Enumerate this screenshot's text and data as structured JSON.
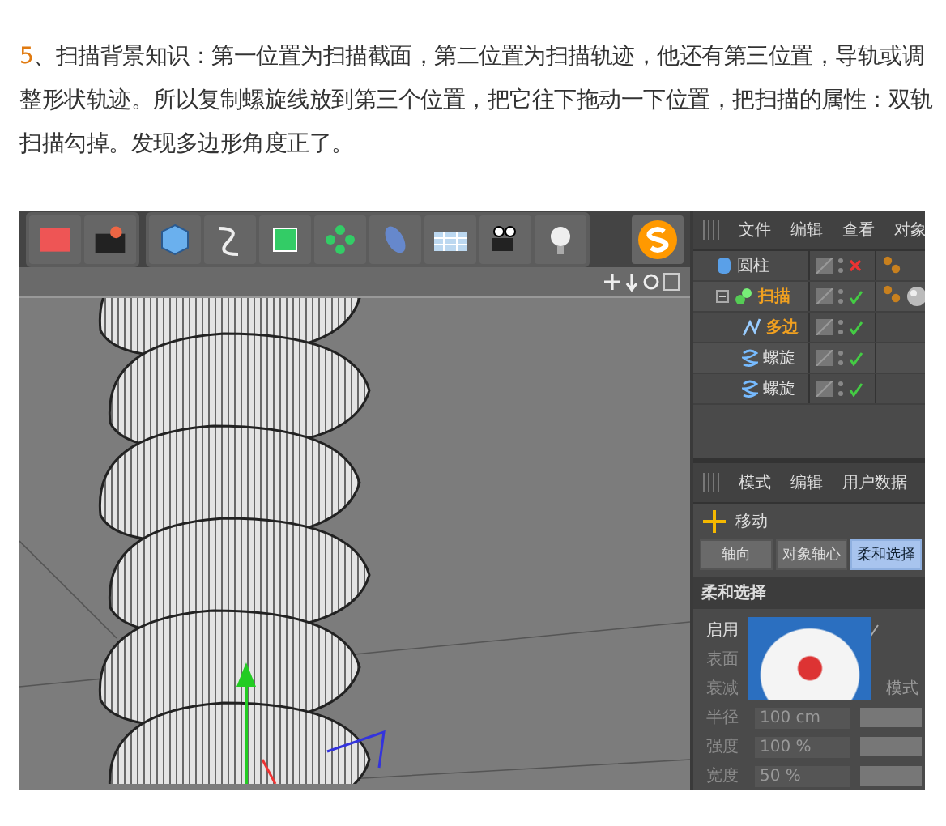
{
  "article": {
    "number": "5",
    "text": "、扫描背景知识：第一位置为扫描截面，第二位置为扫描轨迹，他还有第三位置，导轨或调整形状轨迹。所以复制螺旋线放到第三个位置，把它往下拖动一下位置，把扫描的属性：双轨扫描勾掉。发现多边形角度正了。"
  },
  "object_manager": {
    "menu": [
      "文件",
      "编辑",
      "查看",
      "对象"
    ],
    "tree": [
      {
        "kind": "cylinder",
        "name": "圆柱",
        "highlighted": false,
        "enabled": false
      },
      {
        "kind": "sweep",
        "name": "扫描",
        "highlighted": true,
        "enabled": true,
        "expanded": true,
        "children": [
          {
            "kind": "spline",
            "name": "多边",
            "highlighted": true,
            "enabled": true
          },
          {
            "kind": "helix",
            "name": "螺旋",
            "highlighted": false,
            "enabled": true
          },
          {
            "kind": "helix",
            "name": "螺旋",
            "highlighted": false,
            "enabled": true
          }
        ]
      }
    ]
  },
  "attributes": {
    "menu": [
      "模式",
      "编辑",
      "用户数据"
    ],
    "tool": "移动",
    "tabs": [
      {
        "label": "轴向",
        "selected": false
      },
      {
        "label": "对象轴心",
        "selected": false
      },
      {
        "label": "柔和选择",
        "selected": true
      }
    ],
    "section": "柔和选择",
    "rows": [
      {
        "kind": "check",
        "label": "启用",
        "checked": true
      },
      {
        "kind": "blank",
        "label": "表面"
      },
      {
        "kind": "label",
        "label": "衰减",
        "extra": "模式"
      },
      {
        "kind": "number",
        "label": "半径",
        "value": "100 cm"
      },
      {
        "kind": "number",
        "label": "强度",
        "value": "100 %"
      },
      {
        "kind": "number",
        "label": "宽度",
        "value": "50 %"
      }
    ]
  }
}
